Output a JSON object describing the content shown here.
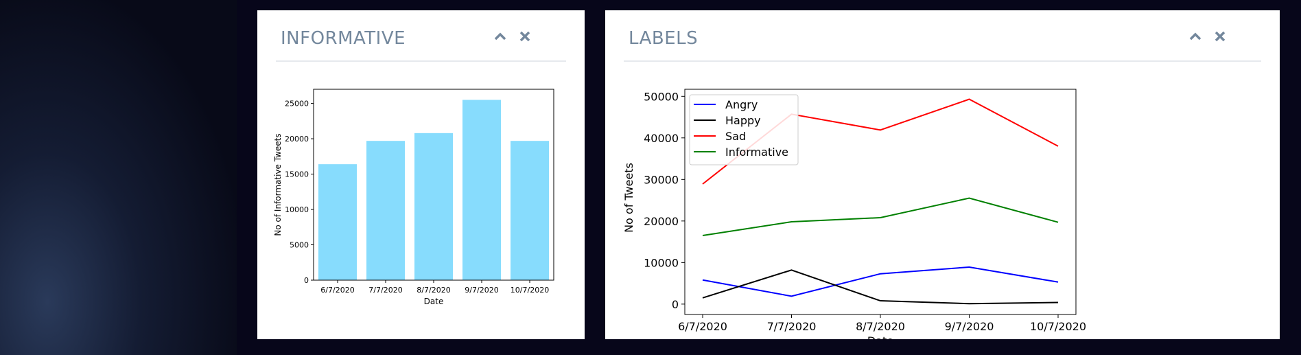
{
  "panels": {
    "informative": {
      "title": "INFORMATIVE",
      "collapse_icon": "chevron-up-icon",
      "close_icon": "close-icon"
    },
    "labels": {
      "title": "LABELS",
      "collapse_icon": "chevron-up-icon",
      "close_icon": "close-icon"
    }
  },
  "chart_data": [
    {
      "type": "bar",
      "categories": [
        "6/7/2020",
        "7/7/2020",
        "8/7/2020",
        "9/7/2020",
        "10/7/2020"
      ],
      "values": [
        16400,
        19700,
        20800,
        25500,
        19700
      ],
      "xlabel": "Date",
      "ylabel": "No of Informative Tweets",
      "ylim": [
        0,
        27000
      ],
      "yticks": [
        0,
        5000,
        10000,
        15000,
        20000,
        25000
      ],
      "color": "#87dcfd",
      "grid": false
    },
    {
      "type": "line",
      "categories": [
        "6/7/2020",
        "7/7/2020",
        "8/7/2020",
        "9/7/2020",
        "10/7/2020"
      ],
      "series": [
        {
          "name": "Angry",
          "values": [
            5800,
            1900,
            7300,
            8900,
            5300
          ],
          "color": "#0000ff"
        },
        {
          "name": "Happy",
          "values": [
            1500,
            8200,
            800,
            100,
            400
          ],
          "color": "#000000"
        },
        {
          "name": "Sad",
          "values": [
            28900,
            45700,
            41900,
            49300,
            38000
          ],
          "color": "#ff0000"
        },
        {
          "name": "Informative",
          "values": [
            16500,
            19800,
            20800,
            25500,
            19700
          ],
          "color": "#008000"
        }
      ],
      "xlabel": "Date",
      "ylabel": "No of Tweets",
      "ylim": [
        -2500,
        51700
      ],
      "yticks": [
        0,
        10000,
        20000,
        30000,
        40000,
        50000
      ],
      "legend": "top-left",
      "grid": false
    }
  ]
}
